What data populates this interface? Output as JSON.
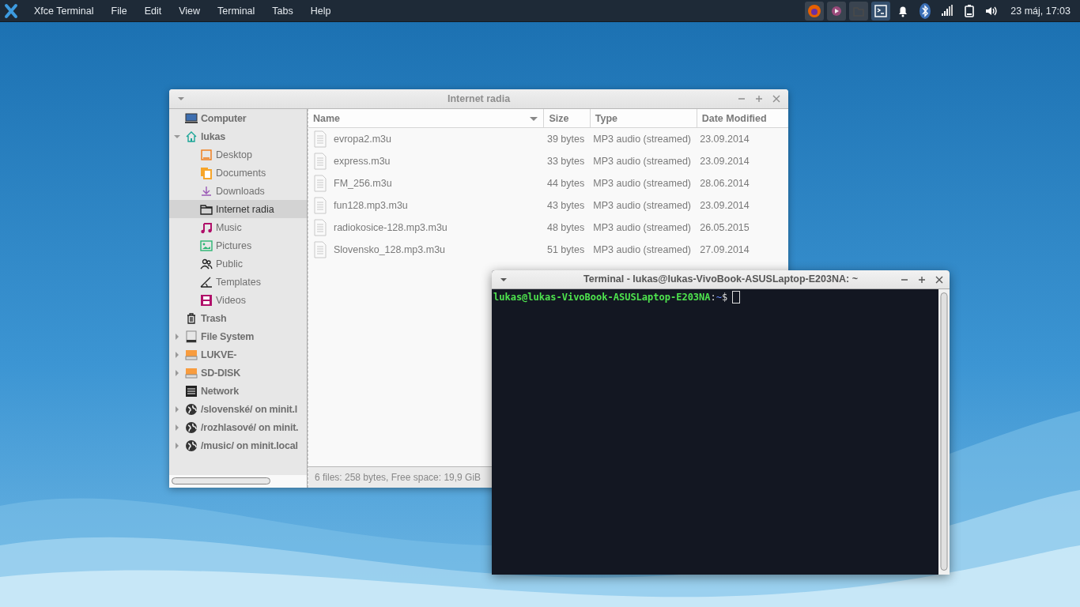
{
  "panel": {
    "app_name": "Xfce Terminal",
    "menus": [
      "File",
      "Edit",
      "View",
      "Terminal",
      "Tabs",
      "Help"
    ],
    "tray": [
      {
        "kind": "browser",
        "selected": false
      },
      {
        "kind": "player",
        "selected": false
      },
      {
        "kind": "files",
        "selected": false
      },
      {
        "kind": "terminal",
        "selected": true
      },
      {
        "kind": "bell",
        "selected": false
      },
      {
        "kind": "bluetooth",
        "selected": false
      },
      {
        "kind": "signal",
        "selected": false
      },
      {
        "kind": "battery",
        "selected": false
      },
      {
        "kind": "volume",
        "selected": false
      }
    ],
    "clock": "23 máj, 17:03"
  },
  "file_manager": {
    "window": {
      "title": "Internet radia",
      "focused": false
    },
    "sidebar": {
      "items": [
        {
          "label": "Computer",
          "kind": "computer",
          "selected": false
        },
        {
          "label": "lukas",
          "kind": "home",
          "selected": false,
          "expanded": true,
          "children": [
            {
              "label": "Desktop",
              "kind": "desktop",
              "selected": false
            },
            {
              "label": "Documents",
              "kind": "documents",
              "selected": false
            },
            {
              "label": "Downloads",
              "kind": "downloads",
              "selected": false
            },
            {
              "label": "Internet radia",
              "kind": "folder",
              "selected": true
            },
            {
              "label": "Music",
              "kind": "music",
              "selected": false
            },
            {
              "label": "Pictures",
              "kind": "pictures",
              "selected": false
            },
            {
              "label": "Public",
              "kind": "public",
              "selected": false
            },
            {
              "label": "Templates",
              "kind": "templates",
              "selected": false
            },
            {
              "label": "Videos",
              "kind": "videos",
              "selected": false
            }
          ]
        },
        {
          "label": "Trash",
          "kind": "trash",
          "selected": false
        },
        {
          "label": "File System",
          "kind": "disk",
          "selected": false,
          "expanded": false
        },
        {
          "label": "LUKVE-",
          "kind": "usb",
          "selected": false,
          "expanded": false
        },
        {
          "label": "SD-DISK",
          "kind": "usb",
          "selected": false,
          "expanded": false
        },
        {
          "label": "Network",
          "kind": "network",
          "selected": false
        },
        {
          "label": "/slovenské/ on minit.l",
          "kind": "share",
          "selected": false,
          "expanded": false
        },
        {
          "label": "/rozhlasové/ on minit.",
          "kind": "share",
          "selected": false,
          "expanded": false
        },
        {
          "label": "/music/ on minit.local",
          "kind": "share",
          "selected": false,
          "expanded": false
        }
      ]
    },
    "table": {
      "columns": [
        {
          "label": "Name",
          "sorted": true
        },
        {
          "label": "Size",
          "sorted": false
        },
        {
          "label": "Type",
          "sorted": false
        },
        {
          "label": "Date Modified",
          "sorted": false
        }
      ],
      "rows": [
        [
          "evropa2.m3u",
          "39 bytes",
          "MP3 audio (streamed)",
          "23.09.2014"
        ],
        [
          "express.m3u",
          "33 bytes",
          "MP3 audio (streamed)",
          "23.09.2014"
        ],
        [
          "FM_256.m3u",
          "44 bytes",
          "MP3 audio (streamed)",
          "28.06.2014"
        ],
        [
          "fun128.mp3.m3u",
          "43 bytes",
          "MP3 audio (streamed)",
          "23.09.2014"
        ],
        [
          "radiokosice-128.mp3.m3u",
          "48 bytes",
          "MP3 audio (streamed)",
          "26.05.2015"
        ],
        [
          "Slovensko_128.mp3.m3u",
          "51 bytes",
          "MP3 audio (streamed)",
          "27.09.2014"
        ]
      ]
    },
    "status_bar": "6 files: 258 bytes, Free space: 19,9 GiB"
  },
  "terminal": {
    "window": {
      "title": "Terminal - lukas@lukas-VivoBook-ASUSLaptop-E203NA: ~",
      "focused": true
    },
    "prompt": {
      "user_host": "lukas@lukas-VivoBook-ASUSLaptop-E203NA",
      "separator": ":",
      "path": "~",
      "symbol": "$"
    }
  }
}
